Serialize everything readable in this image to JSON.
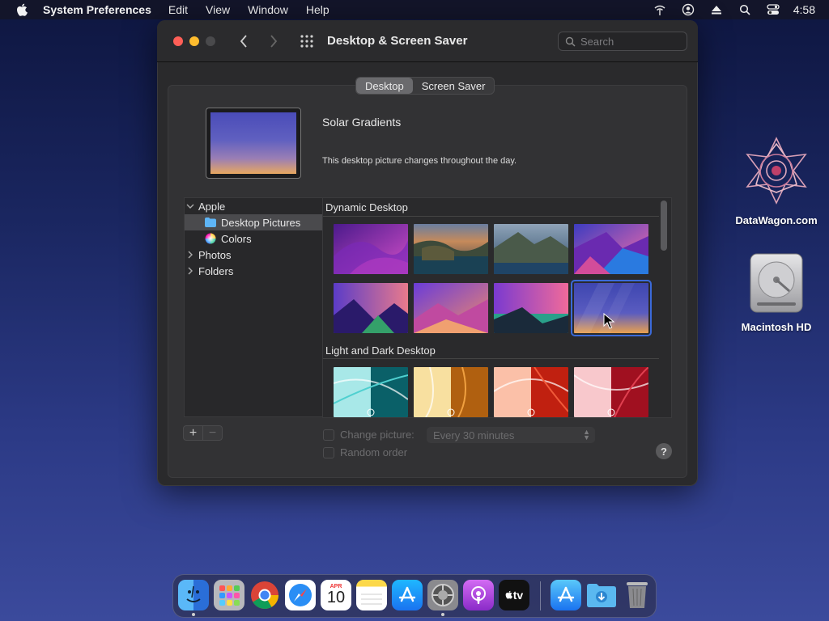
{
  "menubar": {
    "app_name": "System Preferences",
    "menus": [
      "Edit",
      "View",
      "Window",
      "Help"
    ],
    "clock": "4:58",
    "icons": [
      "apple-logo-icon",
      "network-icon",
      "user-account-icon",
      "eject-icon",
      "spotlight-search-icon",
      "control-center-icon"
    ]
  },
  "desktop_icons": [
    {
      "label": "DataWagon.com",
      "icon": "datawagon-logo-icon"
    },
    {
      "label": "Macintosh HD",
      "icon": "hard-drive-icon"
    }
  ],
  "window": {
    "title": "Desktop & Screen Saver",
    "search_placeholder": "Search",
    "tabs": [
      {
        "label": "Desktop",
        "active": true
      },
      {
        "label": "Screen Saver",
        "active": false
      }
    ],
    "wallpaper_name": "Solar Gradients",
    "wallpaper_desc": "This desktop picture changes throughout the day.",
    "sidebar": [
      {
        "label": "Apple",
        "expanded": true
      },
      {
        "label": "Desktop Pictures",
        "selected": true
      },
      {
        "label": "Colors"
      },
      {
        "label": "Photos"
      },
      {
        "label": "Folders"
      }
    ],
    "sections": [
      {
        "title": "Dynamic Desktop"
      },
      {
        "title": "Light and Dark Desktop"
      }
    ],
    "options": {
      "change_picture_label": "Change picture:",
      "interval_value": "Every 30 minutes",
      "random_order_label": "Random order"
    },
    "help_label": "?"
  },
  "dock": {
    "apps": [
      "Finder",
      "Launchpad",
      "Google Chrome",
      "Safari",
      "Calendar",
      "Notes",
      "App Store",
      "System Preferences",
      "Podcasts",
      "TV",
      "Applications",
      "Downloads",
      "Trash"
    ],
    "calendar_month": "APR",
    "calendar_day": "10",
    "tv_label": "tv"
  }
}
